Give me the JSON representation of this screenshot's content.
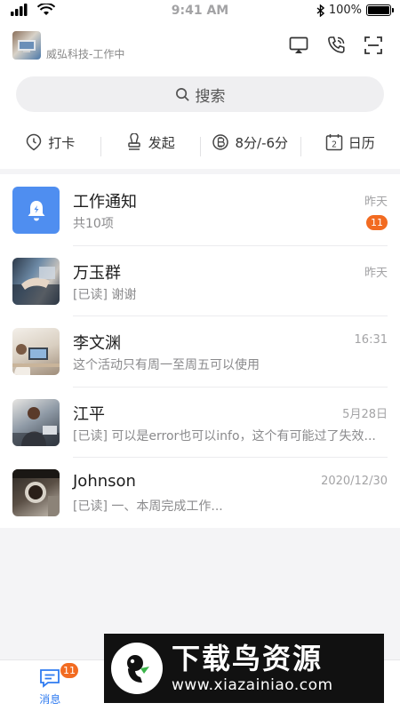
{
  "status_bar": {
    "time": "9:41 AM",
    "battery": "100%",
    "battery_level": 1.0
  },
  "header": {
    "org_name": "威弘科技-工作中",
    "icons": [
      "screen-cast-icon",
      "phone-icon",
      "scan-icon"
    ]
  },
  "search": {
    "placeholder": "搜索"
  },
  "quick_actions": [
    {
      "label": "打卡",
      "icon": "location-pin-icon"
    },
    {
      "label": "发起",
      "icon": "approval-stamp-icon"
    },
    {
      "label": "8分/-6分",
      "icon": "coin-icon"
    },
    {
      "label": "日历",
      "icon": "calendar-icon",
      "icon_text": "2"
    }
  ],
  "conversations": [
    {
      "name": "工作通知",
      "preview": "共10项",
      "time": "昨天",
      "badge": "11",
      "avatar": "bell-icon"
    },
    {
      "name": "万玉群",
      "preview": "[已读] 谢谢",
      "time": "昨天",
      "badge": "",
      "avatar": "photo"
    },
    {
      "name": "李文渊",
      "preview": "这个活动只有周一至周五可以使用",
      "time": "16:31",
      "badge": "",
      "avatar": "photo"
    },
    {
      "name": "江平",
      "preview": "[已读] 可以是error也可以info，这个有可能过了失效...",
      "time": "5月28日",
      "badge": "",
      "avatar": "photo"
    },
    {
      "name": "Johnson",
      "preview": "[已读] 一、本周完成工作...",
      "time": "2020/12/30",
      "badge": "",
      "avatar": "photo"
    }
  ],
  "tabbar": {
    "active_label": "消息",
    "active_badge": "11"
  },
  "watermark": {
    "title": "下载鸟资源",
    "url": "www.xiazainiao.com"
  },
  "colors": {
    "accent": "#2f7bf0",
    "badge": "#f26b21",
    "bell_tile": "#4f8ef0"
  }
}
